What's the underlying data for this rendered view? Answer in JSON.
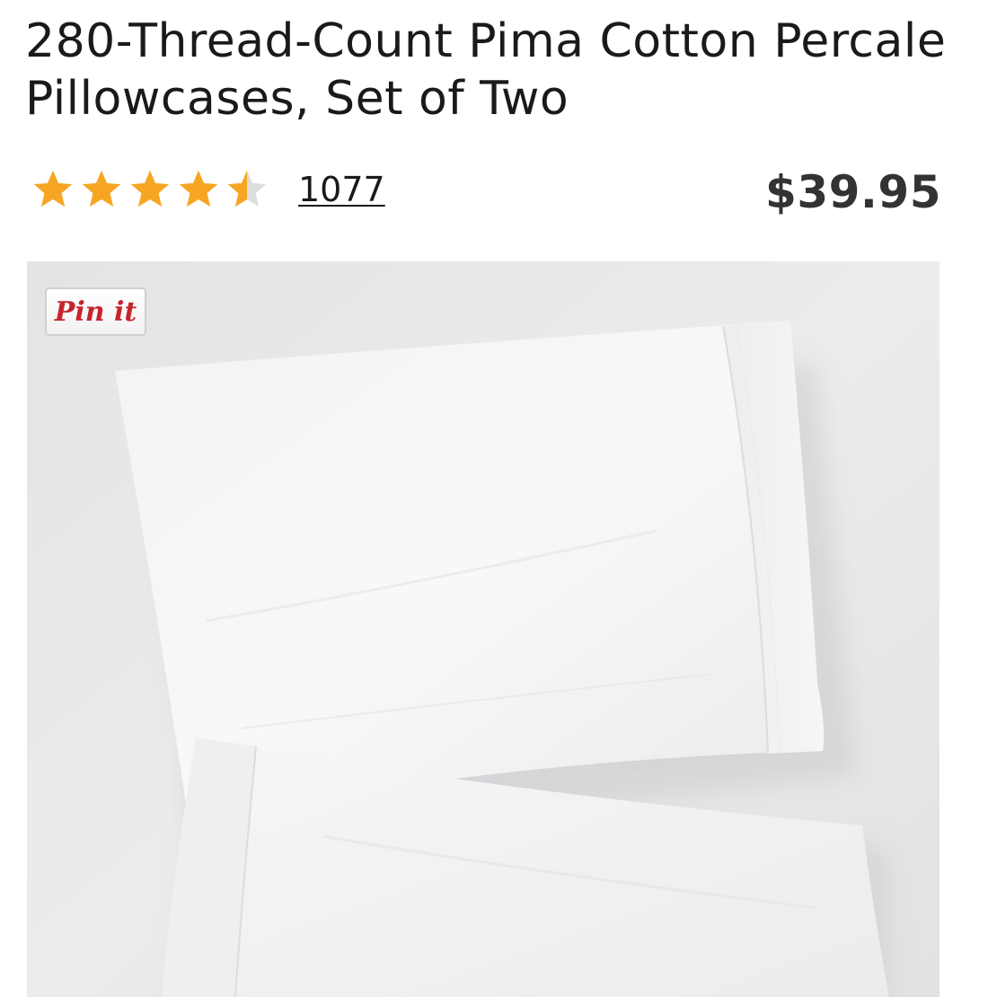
{
  "product": {
    "title": "280-Thread-Count Pima Cotton Percale Pillowcases, Set of Two",
    "rating": 4.5,
    "rating_max": 5,
    "review_count": "1077",
    "price": "$39.95"
  },
  "image": {
    "pin_label": "Pin it",
    "subject": "white-pillowcases-photo"
  },
  "colors": {
    "star_filled": "#F6A623",
    "star_empty": "#DDDDDD",
    "pin_red": "#C8232C",
    "price_text": "#333333"
  }
}
